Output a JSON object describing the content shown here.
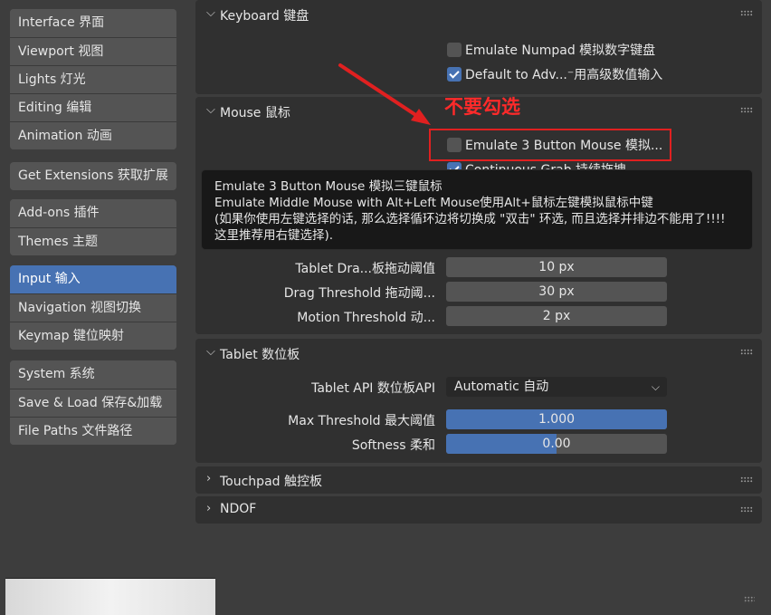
{
  "sidebar": {
    "groups": [
      {
        "items": [
          {
            "label": "Interface 界面"
          },
          {
            "label": "Viewport 视图"
          },
          {
            "label": "Lights 灯光"
          },
          {
            "label": "Editing 编辑"
          },
          {
            "label": "Animation 动画"
          }
        ]
      },
      {
        "items": [
          {
            "label": "Get Extensions 获取扩展"
          }
        ]
      },
      {
        "items": [
          {
            "label": "Add-ons 插件"
          },
          {
            "label": "Themes 主题"
          }
        ]
      },
      {
        "items": [
          {
            "label": "Input 输入",
            "active": true
          },
          {
            "label": "Navigation 视图切换"
          },
          {
            "label": "Keymap 键位映射"
          }
        ]
      },
      {
        "items": [
          {
            "label": "System 系统"
          },
          {
            "label": "Save & Load 保存&加载"
          },
          {
            "label": "File Paths 文件路径"
          }
        ]
      }
    ]
  },
  "keyboard": {
    "title": "Keyboard 键盘",
    "emulate_numpad": {
      "label": "Emulate Numpad 模拟数字键盘",
      "checked": false
    },
    "default_adv": {
      "label": "Default to Adv...⁻用高级数值输入",
      "checked": true
    }
  },
  "mouse": {
    "title": "Mouse 鼠标",
    "emulate_3button": {
      "label": "Emulate 3 Button Mouse 模拟...",
      "checked": false
    },
    "continuous_grab": {
      "label": "Continuous Grab 持续拖拽",
      "checked": true
    },
    "tablet_drag": {
      "label": "Tablet Dra...板拖动阈值",
      "value": "10 px"
    },
    "drag_threshold": {
      "label": "Drag Threshold 拖动阈...",
      "value": "30 px"
    },
    "motion_threshold": {
      "label": "Motion Threshold 动...",
      "value": "2 px"
    }
  },
  "tooltip": {
    "line1": "Emulate 3 Button Mouse 模拟三键鼠标",
    "line2": "Emulate Middle Mouse with Alt+Left Mouse使用Alt+鼠标左键模拟鼠标中键",
    "line3": "(如果你使用左键选择的话, 那么选择循环边将切换成 \"双击\" 环选, 而且选择并排边不能用了!!!!",
    "line4": "这里推荐用右键选择)."
  },
  "tablet": {
    "title": "Tablet 数位板",
    "api": {
      "label": "Tablet API 数位板API",
      "value": "Automatic 自动"
    },
    "max_threshold": {
      "label": "Max Threshold 最大阈值",
      "value": "1.000",
      "fraction": 1.0
    },
    "softness": {
      "label": "Softness 柔和",
      "value": "0.00",
      "fraction": 0.5
    }
  },
  "touchpad": {
    "title": "Touchpad 触控板"
  },
  "ndof": {
    "title": "NDOF"
  },
  "annotation": {
    "text": "不要勾选"
  },
  "colors": {
    "accent": "#4772b3",
    "annotation": "#e02020",
    "panel": "#303030",
    "background": "#3d3d3d"
  }
}
